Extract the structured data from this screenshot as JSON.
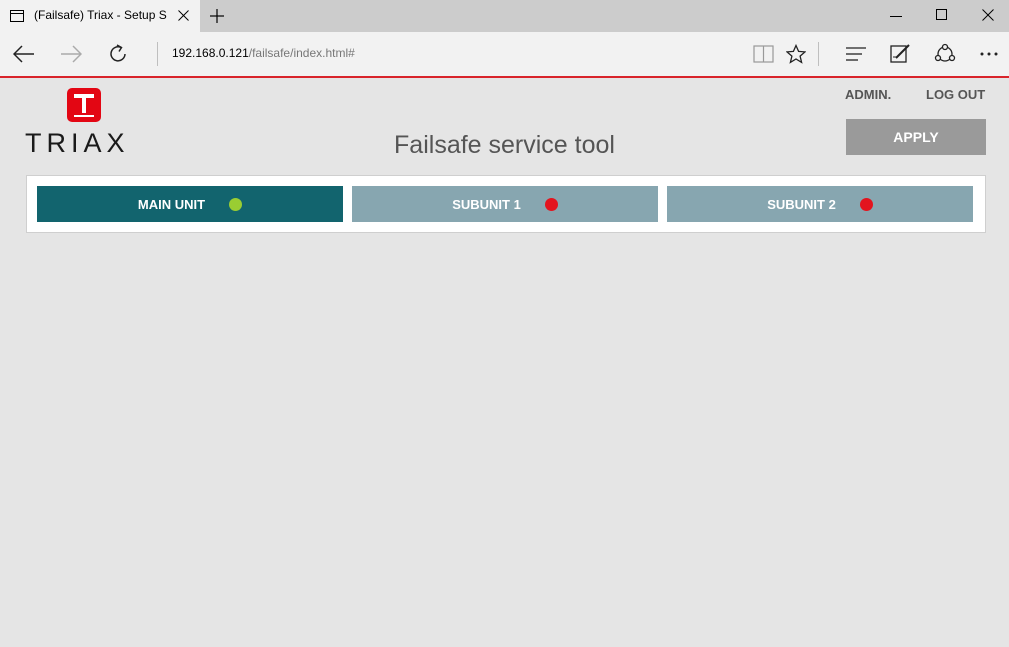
{
  "browser": {
    "tab_title": "(Failsafe) Triax - Setup S",
    "address_host": "192.168.0.121",
    "address_path": "/failsafe/index.html#"
  },
  "page": {
    "logo_text": "TRIAX",
    "title": "Failsafe service tool",
    "admin_link": "ADMIN.",
    "logout_link": "LOG OUT",
    "apply_label": "APPLY"
  },
  "units": [
    {
      "label": "MAIN UNIT",
      "status": "ok",
      "status_color": "#9acd32",
      "bg": "#12646e"
    },
    {
      "label": "SUBUNIT 1",
      "status": "error",
      "status_color": "#e3141e",
      "bg": "#87a6b0"
    },
    {
      "label": "SUBUNIT 2",
      "status": "error",
      "status_color": "#e3141e",
      "bg": "#87a6b0"
    }
  ],
  "colors": {
    "accent_red": "#d9242b",
    "apply_bg": "#9a9a9a"
  }
}
